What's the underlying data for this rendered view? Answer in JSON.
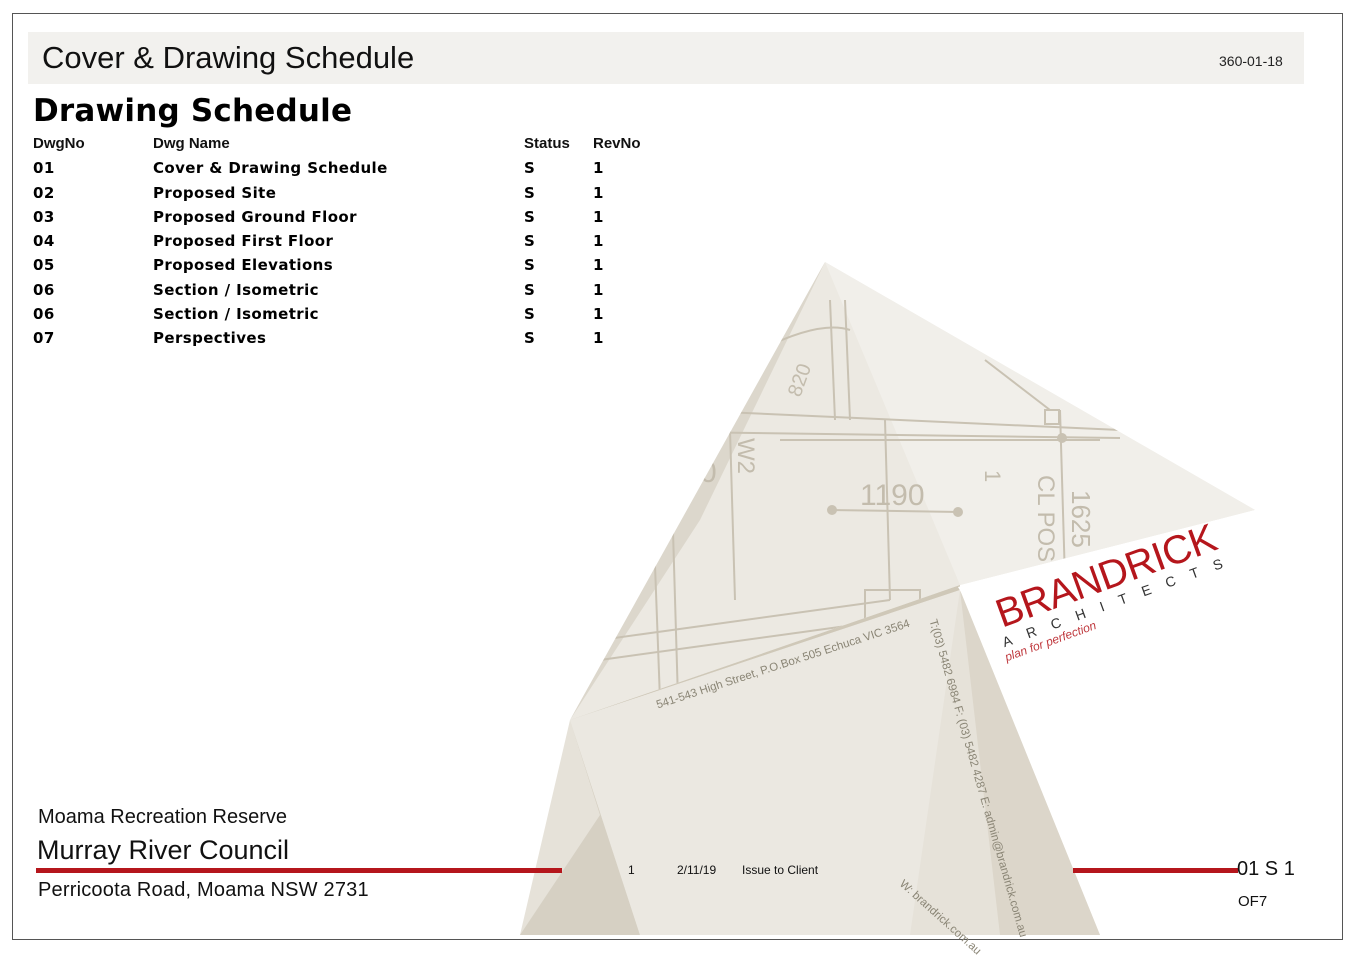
{
  "header": {
    "sheet_title": "Cover & Drawing Schedule",
    "project_number": "360-01-18"
  },
  "schedule": {
    "heading": "Drawing Schedule",
    "columns": {
      "dwg_no": "DwgNo",
      "dwg_name": "Dwg Name",
      "status": "Status",
      "rev_no": "RevNo"
    },
    "rows": [
      {
        "no": "01",
        "name": "Cover & Drawing Schedule",
        "status": "S",
        "rev": "1"
      },
      {
        "no": "02",
        "name": "Proposed Site",
        "status": "S",
        "rev": "1"
      },
      {
        "no": "03",
        "name": "Proposed Ground Floor",
        "status": "S",
        "rev": "1"
      },
      {
        "no": "04",
        "name": "Proposed First Floor",
        "status": "S",
        "rev": "1"
      },
      {
        "no": "05",
        "name": "Proposed Elevations",
        "status": "S",
        "rev": "1"
      },
      {
        "no": "06",
        "name": "Section / Isometric",
        "status": "S",
        "rev": "1"
      },
      {
        "no": "06",
        "name": "Section / Isometric",
        "status": "S",
        "rev": "1"
      },
      {
        "no": "07",
        "name": "Perspectives",
        "status": "S",
        "rev": "1"
      }
    ]
  },
  "title_block": {
    "project_name": "Moama Recreation Reserve",
    "client_name": "Murray River Council",
    "site_address": "Perricoota Road, Moama NSW 2731",
    "revision": {
      "rev": "1",
      "date": "2/11/19",
      "description": "Issue to Client"
    },
    "sheet_code": "01 S 1",
    "sheet_total": "OF7"
  },
  "brand": {
    "name": "BRANDRICK",
    "subtitle": "ARCHITECTS",
    "tagline": "plan for perfection",
    "postal_address": "541-543 High Street, P.O.Box 505 Echuca VIC 3564",
    "contact": "T:(03) 5482 6984 F: (03) 5482 4287 E: admin@brandrick.com.au",
    "website": "W: brandrick.com.au"
  },
  "background_drawing": {
    "dimension_labels": [
      "820",
      "W2",
      "1190",
      "1625",
      "1",
      "CL POS",
      "0"
    ]
  },
  "colors": {
    "brand_red": "#b5161c",
    "header_band": "#f2f1ee",
    "artwork_beige": "#e3ded4"
  }
}
